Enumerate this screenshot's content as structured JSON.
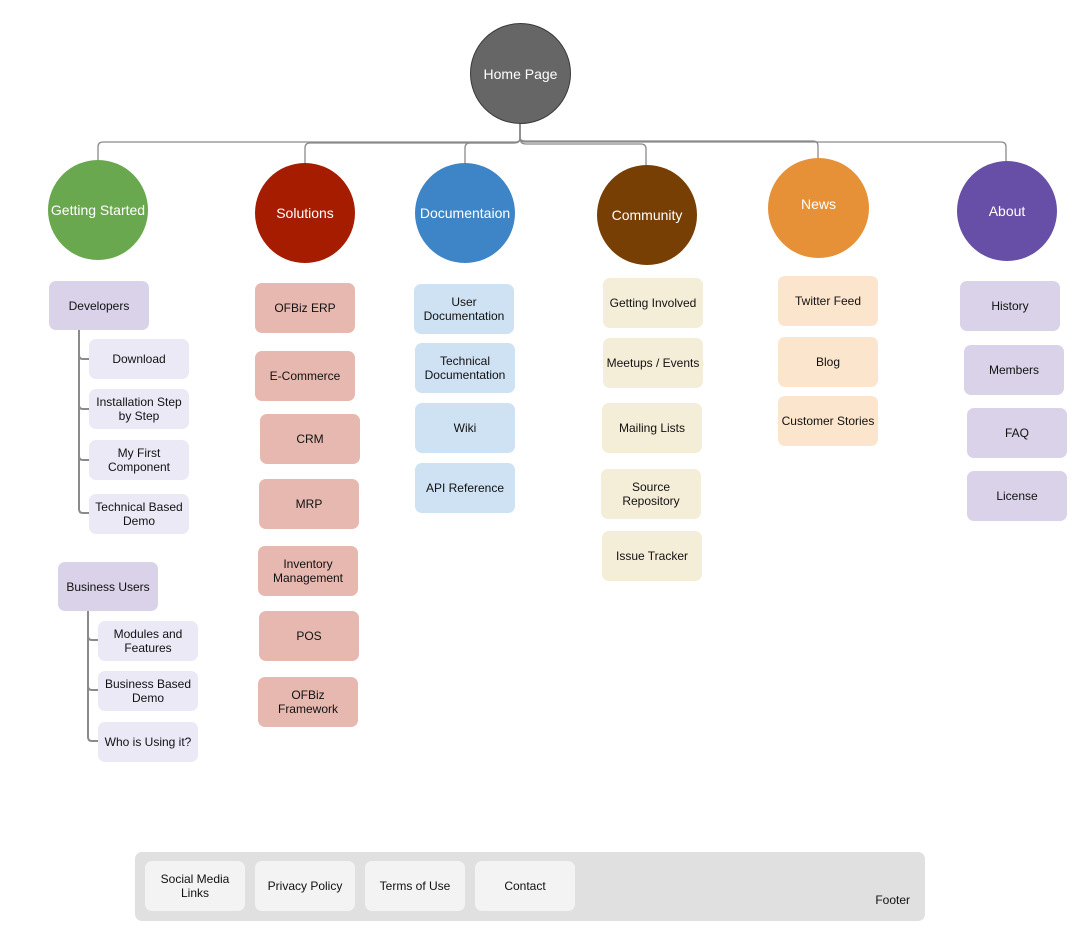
{
  "root": {
    "label": "Home Page",
    "color": "#666666"
  },
  "sections": [
    {
      "id": "getting-started",
      "label": "Getting Started",
      "color": "#6aa84f",
      "groups": [
        {
          "label": "Developers",
          "color": "#d9d2e9",
          "child_color": "#ece9f7",
          "items": [
            "Download",
            "Installation Step by Step",
            "My First Component",
            "Technical Based Demo"
          ]
        },
        {
          "label": "Business Users",
          "color": "#d9d2e9",
          "child_color": "#ece9f7",
          "items": [
            "Modules and Features",
            "Business Based Demo",
            "Who is Using it?"
          ]
        }
      ]
    },
    {
      "id": "solutions",
      "label": "Solutions",
      "color": "#a61c00",
      "item_color": "#e6b8af",
      "items": [
        "OFBiz ERP",
        "E-Commerce",
        "CRM",
        "MRP",
        "Inventory Management",
        "POS",
        "OFBiz Framework"
      ]
    },
    {
      "id": "documentation",
      "label": "Documentaion",
      "color": "#3d85c6",
      "item_color": "#cfe2f3",
      "items": [
        "User Documentation",
        "Technical Documentation",
        "Wiki",
        "API Reference"
      ]
    },
    {
      "id": "community",
      "label": "Community",
      "color": "#783f04",
      "item_color": "#f4edd7",
      "items": [
        "Getting Involved",
        "Meetups / Events",
        "Mailing Lists",
        "Source Repository",
        "Issue Tracker"
      ]
    },
    {
      "id": "news",
      "label": "News",
      "color": "#e69138",
      "item_color": "#fce5cd",
      "items": [
        "Twitter Feed",
        "Blog",
        "Customer Stories"
      ]
    },
    {
      "id": "about",
      "label": "About",
      "color": "#674ea7",
      "item_color": "#d9d2e9",
      "items": [
        "History",
        "Members",
        "FAQ",
        "License"
      ]
    }
  ],
  "footer": {
    "label": "Footer",
    "items": [
      "Social Media Links",
      "Privacy Policy",
      "Terms of Use",
      "Contact"
    ]
  }
}
